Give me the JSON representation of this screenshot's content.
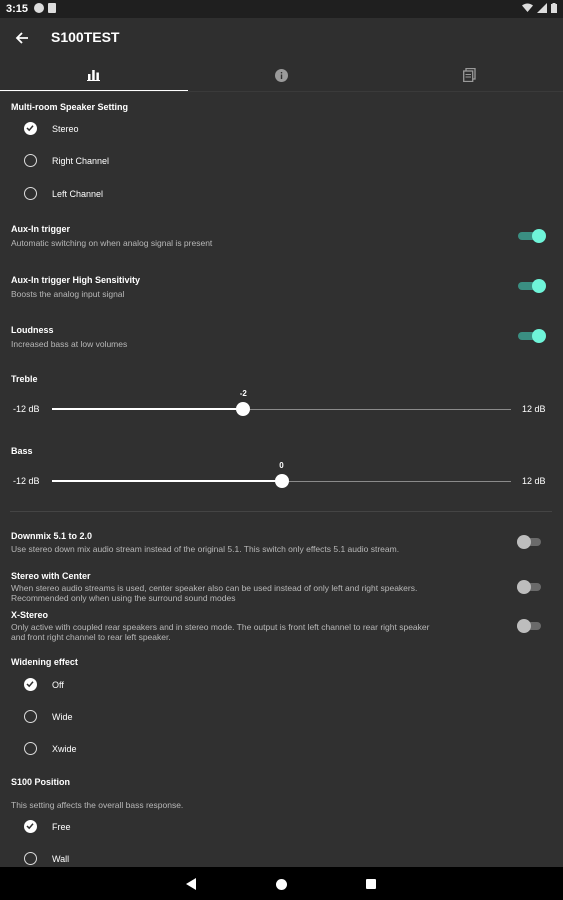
{
  "status": {
    "time": "3:15"
  },
  "appbar": {
    "title": "S100TEST"
  },
  "tabs": [
    {
      "icon": "bar-chart-icon"
    },
    {
      "icon": "info-icon"
    },
    {
      "icon": "documents-icon"
    }
  ],
  "multiroom": {
    "title": "Multi-room Speaker Setting",
    "options": [
      "Stereo",
      "Right Channel",
      "Left Channel"
    ],
    "selected": "Stereo"
  },
  "aux_trigger": {
    "title": "Aux-In trigger",
    "subtitle": "Automatic switching on when analog signal is present",
    "on": true
  },
  "aux_sensitivity": {
    "title": "Aux-In trigger High Sensitivity",
    "subtitle": "Boosts the analog input signal",
    "on": true
  },
  "loudness": {
    "title": "Loudness",
    "subtitle": "Increased bass at low volumes",
    "on": true
  },
  "treble": {
    "title": "Treble",
    "min_label": "-12 dB",
    "max_label": "12 dB",
    "min": -12,
    "max": 12,
    "value": -2,
    "value_label": "-2"
  },
  "bass": {
    "title": "Bass",
    "min_label": "-12 dB",
    "max_label": "12 dB",
    "min": -12,
    "max": 12,
    "value": 0,
    "value_label": "0"
  },
  "downmix": {
    "title": "Downmix 5.1 to 2.0",
    "subtitle": "Use stereo down mix audio stream instead of the original 5.1. This switch only effects 5.1 audio stream.",
    "on": false
  },
  "stereo_center": {
    "title": "Stereo with Center",
    "subtitle1": "When stereo audio streams is used, center speaker also can be used instead of only left and right speakers.",
    "subtitle2": "Recommended only when using the surround sound modes",
    "on": false
  },
  "x_stereo": {
    "title": "X-Stereo",
    "subtitle1": "Only active with coupled rear speakers and in stereo mode. The output is front left channel to rear right speaker",
    "subtitle2": "and front right channel to rear left speaker.",
    "on": false
  },
  "widening": {
    "title": "Widening effect",
    "options": [
      "Off",
      "Wide",
      "Xwide"
    ],
    "selected": "Off"
  },
  "position": {
    "title": "S100 Position",
    "subtitle": "This setting affects the overall bass response.",
    "options": [
      "Free",
      "Wall"
    ],
    "selected": "Free"
  },
  "colors": {
    "accent": "#6ff5d9",
    "background": "#303030",
    "appbar": "#2f2f2f"
  }
}
